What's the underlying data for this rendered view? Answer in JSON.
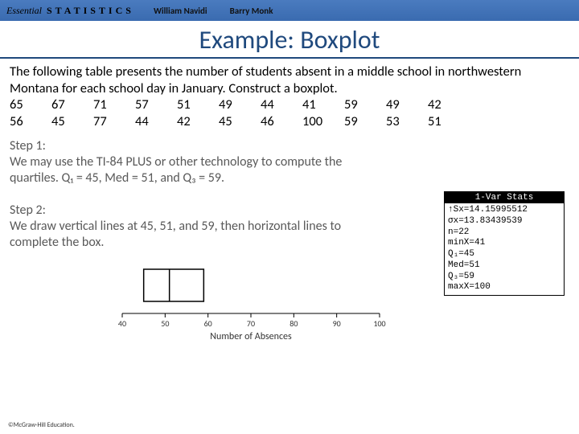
{
  "header": {
    "brand_prefix": "Essential",
    "brand_main": "STATISTICS",
    "authors": [
      "William Navidi",
      "Barry Monk"
    ]
  },
  "title": "Example: Boxplot",
  "prompt": "The following table presents the number of students absent in a middle school in northwestern Montana for each school day in January. Construct a boxplot.",
  "data_rows": [
    [
      "65",
      "67",
      "71",
      "57",
      "51",
      "49",
      "44",
      "41",
      "59",
      "49",
      "42"
    ],
    [
      "56",
      "45",
      "77",
      "44",
      "42",
      "45",
      "46",
      "100",
      "59",
      "53",
      "51"
    ]
  ],
  "step1_label": "Step 1:",
  "step1_text": "We may use the TI-84 PLUS or other technology to compute the quartiles. Q₁ = 45, Med = 51, and Q₃ = 59.",
  "step2_label": "Step 2:",
  "step2_text": "We draw vertical lines at 45, 51, and 59, then horizontal lines to complete the box.",
  "calculator": {
    "title": "1-Var Stats",
    "rows": [
      "↑Sx=14.15995512",
      "σx=13.83439539",
      "n=22",
      "minX=41",
      "Q₁=45",
      "Med=51",
      "Q₃=59",
      "maxX=100"
    ]
  },
  "chart_data": {
    "type": "boxplot-partial",
    "xlabel": "Number of Absences",
    "xticks": [
      40,
      50,
      60,
      70,
      80,
      90,
      100
    ],
    "q1": 45,
    "median": 51,
    "q3": 59,
    "xlim": [
      40,
      100
    ]
  },
  "copyright": "©McGraw-Hill Education."
}
